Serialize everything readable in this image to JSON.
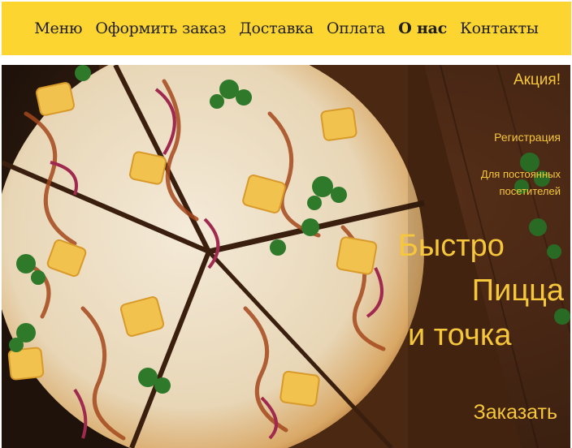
{
  "nav": {
    "items": [
      "Меню",
      "Оформить заказ",
      "Доставка",
      "Оплата",
      "О нас",
      "Контакты"
    ],
    "active": "О нас"
  },
  "hero": {
    "promo": "Акция!",
    "registration": "Регистрация",
    "regular_line1": "Для постоянных",
    "regular_line2": "посетителей",
    "slogan_line1": "Быстро",
    "slogan_line2": "Пицца",
    "slogan_line3": "и точка",
    "order_button": "Заказать"
  },
  "colors": {
    "nav_background": "#fdd530",
    "accent_text": "#f6c73a",
    "nav_text": "#1f1f1f"
  }
}
